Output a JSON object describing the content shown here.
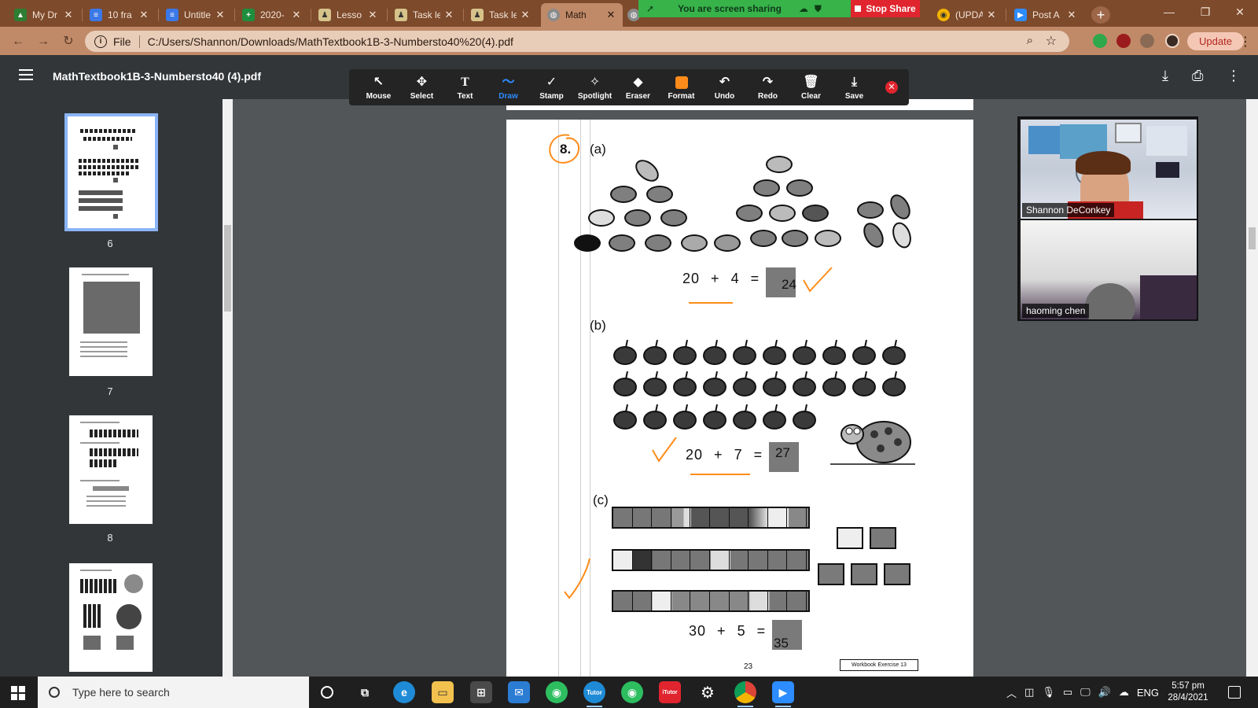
{
  "tabs": [
    {
      "label": "My Dr",
      "icon": "google-drive-icon",
      "color": "#2d7d32"
    },
    {
      "label": "10 fra",
      "icon": "google-docs-icon",
      "color": "#3b78e7"
    },
    {
      "label": "Untitle",
      "icon": "google-docs-icon",
      "color": "#3b78e7"
    },
    {
      "label": "2020-",
      "icon": "google-sheets-icon",
      "color": "#1e8e3e"
    },
    {
      "label": "Lesso",
      "icon": "classroom-icon",
      "color": "#d6c38a"
    },
    {
      "label": "Task le",
      "icon": "classroom-icon",
      "color": "#d6c38a"
    },
    {
      "label": "Task le",
      "icon": "classroom-icon",
      "color": "#d6c38a"
    },
    {
      "label": "Math",
      "icon": "globe-icon",
      "color": "#8a8a8a"
    },
    {
      "label": "(UPDA",
      "icon": "chat-icon",
      "color": "#f4b400"
    },
    {
      "label": "Post A",
      "icon": "zoom-icon",
      "color": "#2d8cff"
    }
  ],
  "share_banner": {
    "text": "You are screen sharing",
    "stop": "Stop Share"
  },
  "window_controls": {
    "minimize": "—",
    "restore": "❐",
    "close": "✕"
  },
  "address": {
    "scheme": "File",
    "url": "C:/Users/Shannon/Downloads/MathTextbook1B-3-Numbersto40%20(4).pdf"
  },
  "update_label": "Update",
  "pdf": {
    "title": "MathTextbook1B-3-Numbersto40 (4).pdf"
  },
  "annotation_tools": [
    {
      "label": "Mouse",
      "icon": "cursor-icon",
      "glyph": "↖"
    },
    {
      "label": "Select",
      "icon": "move-icon",
      "glyph": "✥"
    },
    {
      "label": "Text",
      "icon": "text-icon",
      "glyph": "T"
    },
    {
      "label": "Draw",
      "icon": "draw-icon",
      "glyph": "〜"
    },
    {
      "label": "Stamp",
      "icon": "check-icon",
      "glyph": "✓"
    },
    {
      "label": "Spotlight",
      "icon": "spotlight-icon",
      "glyph": "✧"
    },
    {
      "label": "Eraser",
      "icon": "eraser-icon",
      "glyph": "◆"
    },
    {
      "label": "Format",
      "icon": "color-swatch-icon",
      "glyph": ""
    },
    {
      "label": "Undo",
      "icon": "undo-icon",
      "glyph": "↶"
    },
    {
      "label": "Redo",
      "icon": "redo-icon",
      "glyph": "↷"
    },
    {
      "label": "Clear",
      "icon": "trash-icon",
      "glyph": "🗑"
    },
    {
      "label": "Save",
      "icon": "save-icon",
      "glyph": "⤓"
    }
  ],
  "annotation_selected": "Draw",
  "thumbnails": [
    {
      "page": "6",
      "active": true
    },
    {
      "page": "7",
      "active": false
    },
    {
      "page": "8",
      "active": false
    },
    {
      "page": "",
      "active": false
    }
  ],
  "textbook": {
    "question": "8.",
    "parts": [
      "(a)",
      "(b)",
      "(c)"
    ],
    "eq_a": {
      "left": "20",
      "op": "+",
      "right": "4",
      "eq": "=",
      "answer": "24"
    },
    "eq_b": {
      "left": "20",
      "op": "+",
      "right": "7",
      "eq": "=",
      "answer": "27"
    },
    "eq_c": {
      "left": "30",
      "op": "+",
      "right": "5",
      "eq": "=",
      "answer": "35"
    },
    "page_number": "23",
    "workbook": "Workbook Exercise 13"
  },
  "participants": [
    {
      "name": "Shannon DeConkey"
    },
    {
      "name": "haoming chen"
    }
  ],
  "taskbar": {
    "search_placeholder": "Type here to search",
    "language": "ENG",
    "time": "5:57 pm",
    "date": "28/4/2021"
  }
}
